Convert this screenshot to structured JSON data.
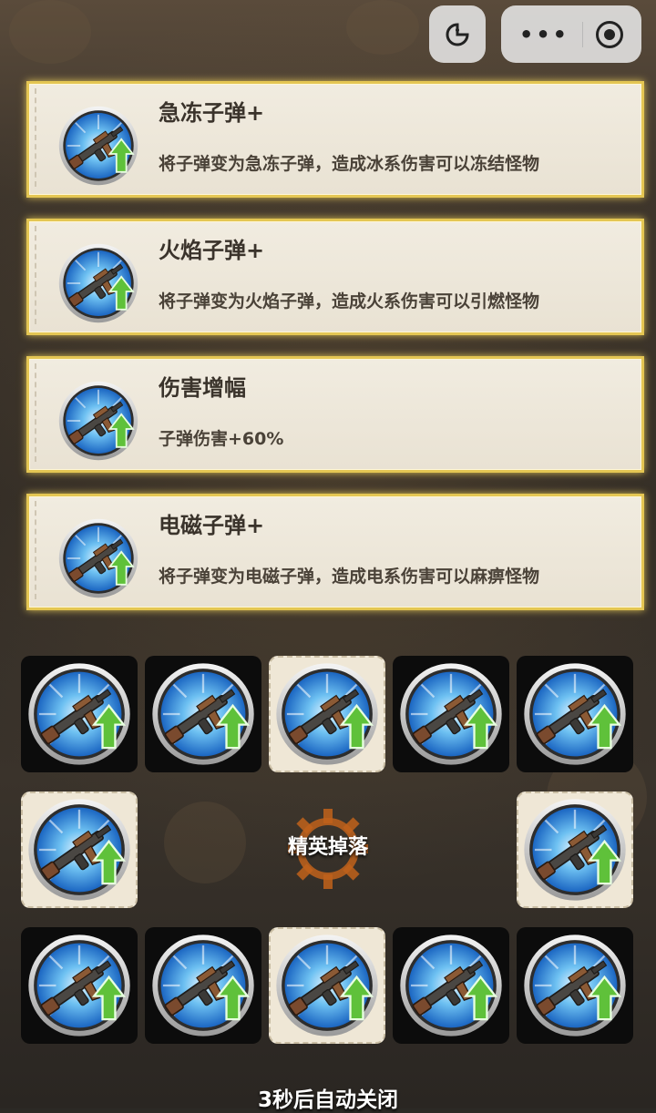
{
  "upgrades": [
    {
      "title": "急冻子弹+",
      "desc": "将子弹变为急冻子弹，造成冰系伤害可以冻结怪物",
      "icon": "rifle-upgrade-icon"
    },
    {
      "title": "火焰子弹+",
      "desc": "将子弹变为火焰子弹，造成火系伤害可以引燃怪物",
      "icon": "rifle-upgrade-icon"
    },
    {
      "title": "伤害增幅",
      "desc": "子弹伤害+60%",
      "icon": "rifle-upgrade-icon"
    },
    {
      "title": "电磁子弹+",
      "desc": "将子弹变为电磁子弹，造成电系伤害可以麻痹怪物",
      "icon": "rifle-upgrade-icon"
    }
  ],
  "elite_drop_label": "精英掉落",
  "auto_close_text": "3秒后自动关闭",
  "grid": {
    "row1": [
      "dark",
      "dark",
      "light",
      "dark",
      "dark"
    ],
    "row2": [
      "light",
      "light"
    ],
    "row3": [
      "dark",
      "dark",
      "light",
      "dark",
      "dark"
    ]
  },
  "colors": {
    "card_border": "#e4c653",
    "card_bg": "#efe9dc",
    "icon_ring": "#2f7fd6",
    "arrow": "#5fc13a"
  }
}
